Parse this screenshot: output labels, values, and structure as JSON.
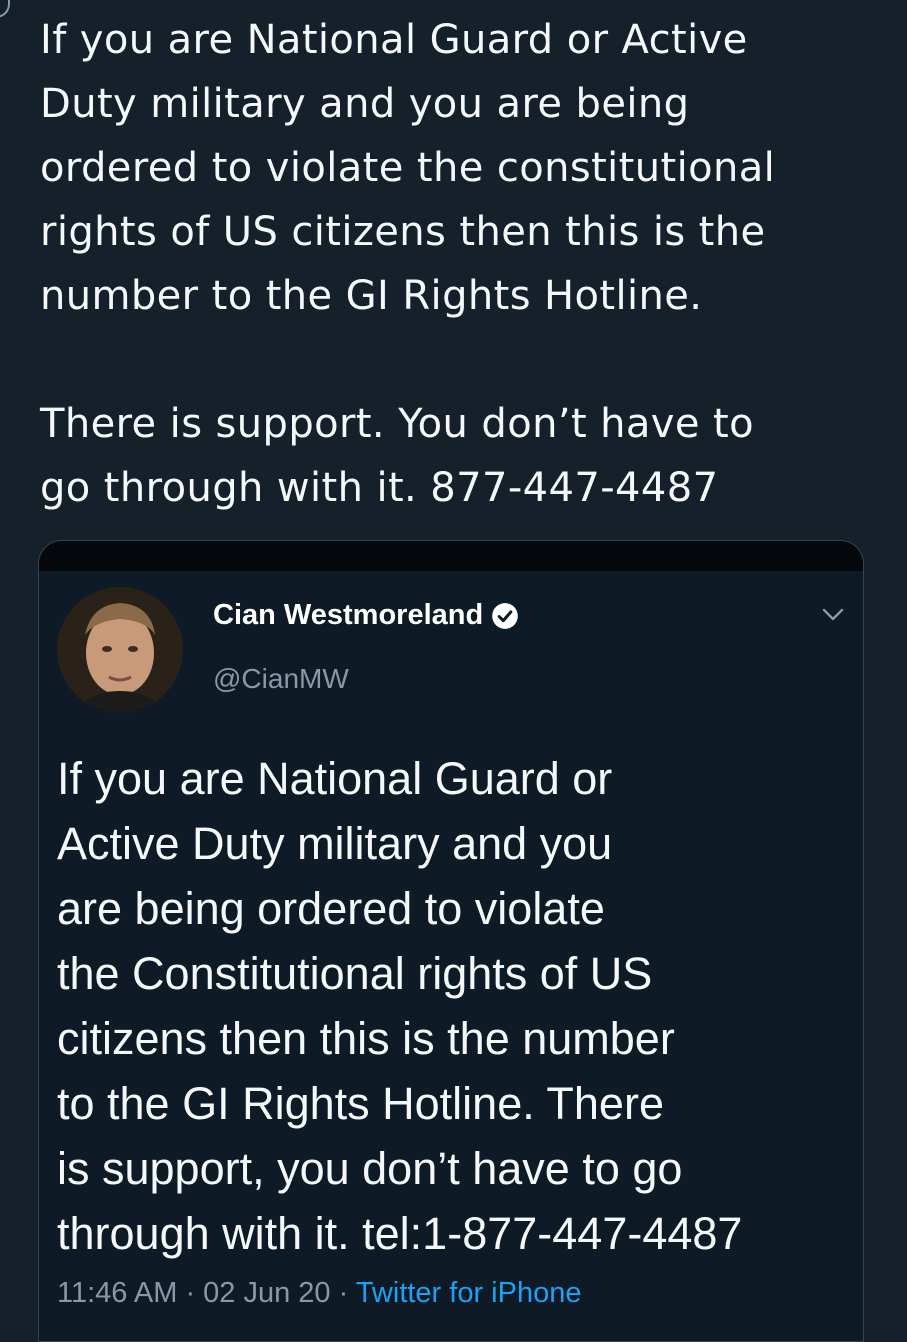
{
  "tweet": {
    "text": "If you are National Guard or Active\nDuty military and you are being\nordered to violate the constitutional\nrights of US citizens then this is the\nnumber to the GI Rights Hotline.\n\nThere is support. You don’t have to\ngo through with it. 877-447-4487"
  },
  "quoted_tweet": {
    "author_name": "Cian Westmoreland",
    "handle": "@CianMW",
    "text": "If you are National Guard or\nActive Duty military and you\nare being ordered to violate\nthe Constitutional rights of US\ncitizens then this is the number\nto the GI Rights Hotline. There\nis support, you don’t have to go\nthrough with it. tel:1-877-447-4487",
    "time": "11:46 AM",
    "date": "02 Jun 20",
    "separator": " · ",
    "source": "Twitter for iPhone",
    "icons": {
      "verified": "verified-badge-icon",
      "menu": "chevron-down-icon"
    }
  },
  "colors": {
    "background": "#15202b",
    "card_background": "#0e1a26",
    "text_primary": "#ffffff",
    "text_secondary": "#8899a6",
    "link": "#1da1f2"
  }
}
